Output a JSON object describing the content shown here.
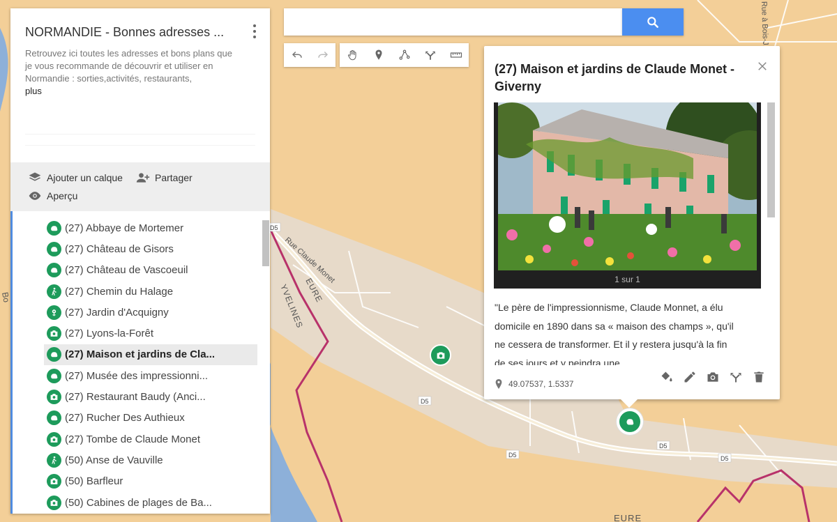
{
  "colors": {
    "accent": "#4b8ef0",
    "marker": "#1d9b5b",
    "map_land": "#f3cf98",
    "map_river": "#8db0d9",
    "border_line": "#b8326a"
  },
  "panel": {
    "title": "NORMANDIE - Bonnes adresses ...",
    "description": "Retrouvez ici toutes les adresses et bons plans que je vous recommande de découvrir et utiliser en Normandie : sorties,activités, restaurants,",
    "more_link": "plus",
    "add_layer": "Ajouter un calque",
    "share": "Partager",
    "preview": "Aperçu"
  },
  "places": [
    {
      "label": "(27) Abbaye de Mortemer",
      "icon": "hand-icon"
    },
    {
      "label": "(27) Château de Gisors",
      "icon": "hand-icon"
    },
    {
      "label": "(27) Château de Vascoeuil",
      "icon": "hand-icon"
    },
    {
      "label": "(27) Chemin du Halage",
      "icon": "hiker-icon"
    },
    {
      "label": "(27) Jardin d'Acquigny",
      "icon": "flower-icon"
    },
    {
      "label": "(27) Lyons-la-Forêt",
      "icon": "camera-icon"
    },
    {
      "label": "(27) Maison et jardins de Cla...",
      "icon": "hand-icon",
      "selected": true
    },
    {
      "label": "(27) Musée des impressionni...",
      "icon": "hand-icon"
    },
    {
      "label": "(27) Restaurant Baudy (Anci...",
      "icon": "camera-icon"
    },
    {
      "label": "(27) Rucher Des Authieux",
      "icon": "hand-icon"
    },
    {
      "label": "(27) Tombe de Claude Monet",
      "icon": "camera-icon"
    },
    {
      "label": "(50) Anse de Vauville",
      "icon": "hiker-icon"
    },
    {
      "label": "(50) Barfleur",
      "icon": "camera-icon"
    },
    {
      "label": "(50) Cabines de plages de Ba...",
      "icon": "camera-icon"
    }
  ],
  "search": {
    "value": "",
    "placeholder": ""
  },
  "toolbar": [
    "undo-icon",
    "redo-icon",
    "pan-hand-icon",
    "add-marker-icon",
    "draw-line-icon",
    "directions-icon",
    "ruler-icon"
  ],
  "info": {
    "title": "(27) Maison et jardins de Claude Monet - Giverny",
    "photo_counter": "1 sur 1",
    "text": "\"Le père de l'impressionnisme, Claude Monnet, a élu domicile en 1890 dans sa « maison des champs », qu'il ne cessera de transformer. Et il y restera jusqu'à la fin de ses jours et y peindra une",
    "coords": "49.07537, 1.5337",
    "actions": [
      "paint-bucket-icon",
      "pencil-icon",
      "camera-icon",
      "directions-icon",
      "trash-icon"
    ]
  },
  "map_labels": {
    "street": "Rue Claude Monet",
    "dept_eure": "EURE",
    "dept_yvelines": "YVELINES",
    "dept_eure_bottom": "EURE",
    "top_road": "Rue à Bois-J...",
    "road_d5_1": "D5",
    "road_d5_2": "D5",
    "road_d5_3": "D5",
    "road_d5_4": "D5",
    "road_d5_5": "D5",
    "edge_letters": "Bo"
  }
}
